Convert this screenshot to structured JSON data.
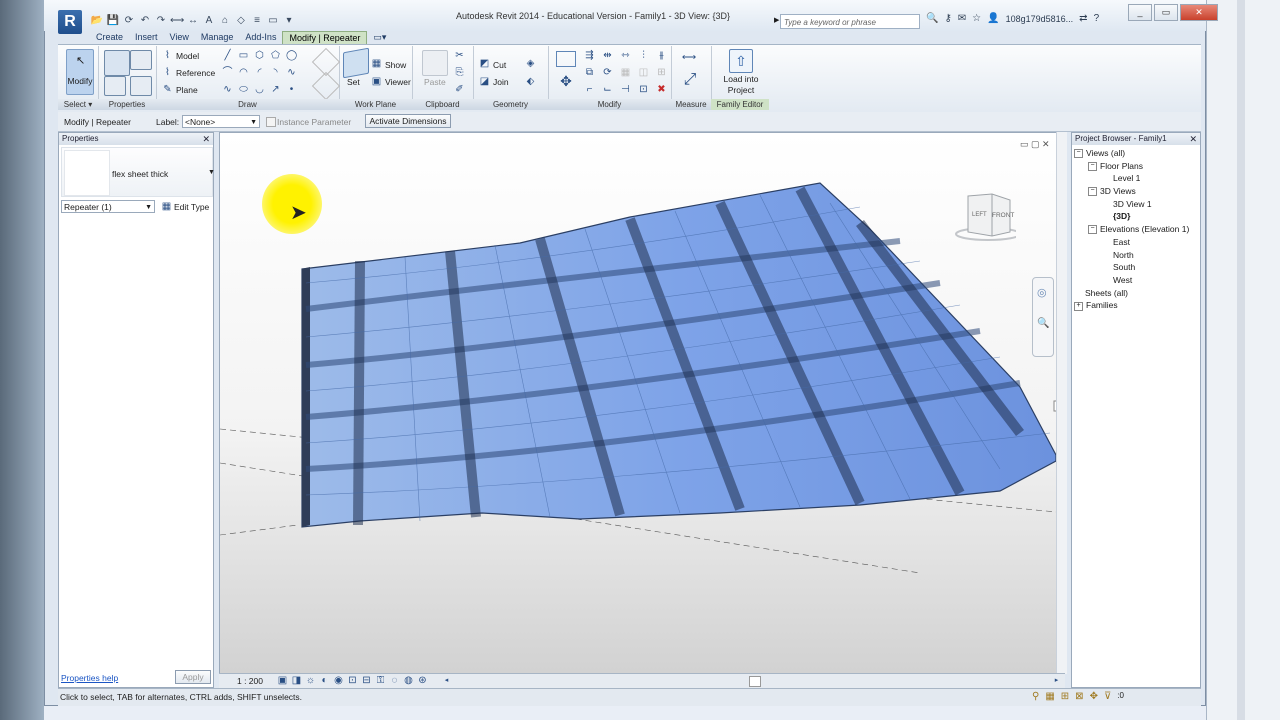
{
  "window": {
    "title": "Autodesk Revit 2014 - Educational Version -     Family1 - 3D View: {3D}",
    "search_placeholder": "Type a keyword or phrase",
    "user": "108g179d5816...",
    "help": "?",
    "controls": {
      "minimize": "_",
      "restore": "▭",
      "close": "✕"
    }
  },
  "menu_tabs": [
    "Create",
    "Insert",
    "View",
    "Manage",
    "Add-Ins",
    "Modify | Repeater"
  ],
  "ribbon": {
    "select": {
      "big_label": "Modify",
      "panel": "Select ▾"
    },
    "properties": {
      "panel": "Properties"
    },
    "draw": {
      "model": "Model",
      "reference": "Reference",
      "plane": "Plane",
      "panel": "Draw"
    },
    "work_plane": {
      "set": "Set",
      "show": "Show",
      "viewer": "Viewer",
      "panel": "Work Plane"
    },
    "clipboard": {
      "paste": "Paste",
      "panel": "Clipboard"
    },
    "geometry": {
      "cut": "Cut",
      "join": "Join",
      "panel": "Geometry"
    },
    "modify": {
      "panel": "Modify"
    },
    "measure": {
      "panel": "Measure"
    },
    "family_editor": {
      "load_into_project": "Load into Project",
      "panel": "Family Editor"
    }
  },
  "options_bar": {
    "context": "Modify | Repeater",
    "label_caption": "Label:",
    "label_value": "<None>",
    "instance_parameter": "Instance Parameter",
    "activate_dimensions": "Activate Dimensions"
  },
  "properties_panel": {
    "title": "Properties",
    "type_name": "flex sheet thick",
    "selector": "Repeater (1)",
    "edit_type": "Edit Type",
    "help_link": "Properties help",
    "apply": "Apply"
  },
  "view_bar": {
    "scale": "1 : 200"
  },
  "viewcube": {
    "left": "LEFT",
    "front": "FRONT"
  },
  "project_browser": {
    "title": "Project Browser - Family1",
    "items": [
      {
        "label": "Views (all)",
        "level": 0,
        "toggle": "−"
      },
      {
        "label": "Floor Plans",
        "level": 1,
        "toggle": "−"
      },
      {
        "label": "Level 1",
        "level": 2,
        "toggle": ""
      },
      {
        "label": "3D Views",
        "level": 1,
        "toggle": "−"
      },
      {
        "label": "3D View 1",
        "level": 2,
        "toggle": ""
      },
      {
        "label": "{3D}",
        "level": 2,
        "toggle": "",
        "bold": true
      },
      {
        "label": "Elevations (Elevation 1)",
        "level": 1,
        "toggle": "−"
      },
      {
        "label": "East",
        "level": 2,
        "toggle": ""
      },
      {
        "label": "North",
        "level": 2,
        "toggle": ""
      },
      {
        "label": "South",
        "level": 2,
        "toggle": ""
      },
      {
        "label": "West",
        "level": 2,
        "toggle": ""
      },
      {
        "label": "Sheets (all)",
        "level": 0,
        "toggle": ""
      },
      {
        "label": "Families",
        "level": 0,
        "toggle": "+"
      }
    ]
  },
  "status_bar": {
    "text": "Click to select, TAB for alternates, CTRL adds, SHIFT unselects.",
    "filter_count": ":0"
  },
  "colors": {
    "accent_green": "#cfe2c6",
    "panel_blue": "#dfe7f1",
    "model_blue": "#6f9be6",
    "cursor_highlight": "#fff200"
  }
}
